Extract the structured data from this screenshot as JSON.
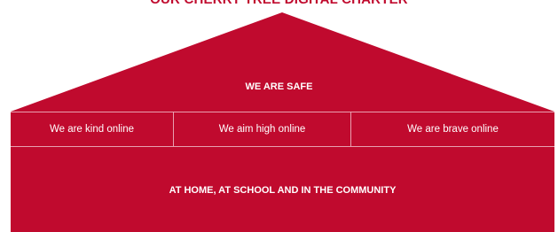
{
  "title": "OUR CHERRY TREE DIGITAL CHARTER",
  "roof": {
    "label": "WE ARE SAFE"
  },
  "pillars": [
    {
      "label": "We are kind online"
    },
    {
      "label": "We aim high online"
    },
    {
      "label": "We are brave online"
    }
  ],
  "base": {
    "label": "AT HOME, AT SCHOOL AND IN THE COMMUNITY"
  },
  "colors": {
    "primary": "#c00a2e",
    "divider": "#e8a0b0",
    "text_on_primary": "#ffffff"
  }
}
